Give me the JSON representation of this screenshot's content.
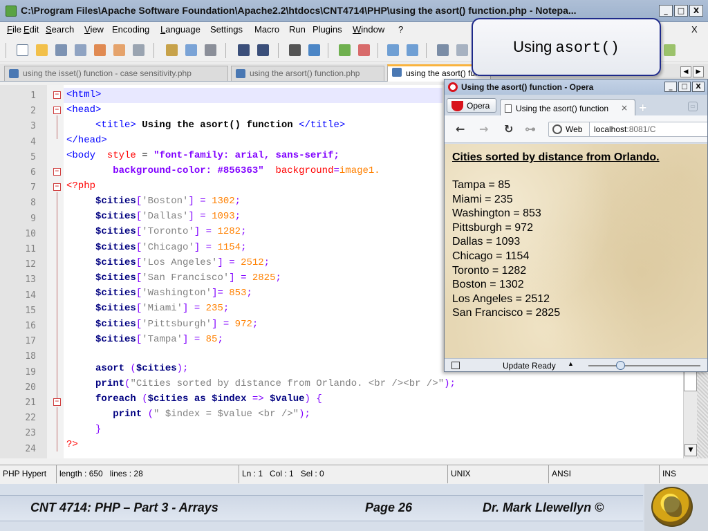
{
  "npp": {
    "title": "C:\\Program Files\\Apache Software Foundation\\Apache2.2\\htdocs\\CNT4714\\PHP\\using the asort() function.php - Notepa...",
    "window_buttons": [
      "_",
      "□",
      "X"
    ],
    "menu": [
      "File",
      "Edit",
      "Search",
      "View",
      "Encoding",
      "Language",
      "Settings",
      "Macro",
      "Run",
      "Plugins",
      "Window",
      "?"
    ],
    "menu_close": "X",
    "tabs": [
      "using the isset() function - case sensitivity.php",
      "using the arsort() function.php",
      "using the asort() function.php"
    ],
    "tab_arrows": [
      "◀",
      "▶"
    ],
    "line_numbers": [
      "1",
      "2",
      "3",
      "4",
      "5",
      "6",
      "7",
      "8",
      "9",
      "10",
      "11",
      "12",
      "13",
      "14",
      "15",
      "16",
      "17",
      "18",
      "19",
      "20",
      "21",
      "22",
      "23",
      "24"
    ],
    "code": {
      "l1": "<html>",
      "l2": "<head>",
      "l3a": "<title>",
      "l3b": " Using the asort() function ",
      "l3c": "</title>",
      "l4": "</head>",
      "l5a": "<body",
      "l5b": "style",
      "l5c": " = ",
      "l5d": "\"font-family: arial, sans-serif;",
      "l6a": "background-color: #856363\"",
      "l6b": "background",
      "l6c": "=",
      "l6d": "image1.",
      "l7": "<?php",
      "cities": [
        {
          "key": "'Boston'",
          "val": "1302"
        },
        {
          "key": "'Dallas'",
          "val": "1093"
        },
        {
          "key": "'Toronto'",
          "val": "1282"
        },
        {
          "key": "'Chicago'",
          "val": "1154"
        },
        {
          "key": "'Los Angeles'",
          "val": "2512"
        },
        {
          "key": "'San Francisco'",
          "val": "2825"
        },
        {
          "key": "'Washington'",
          "val": "853"
        },
        {
          "key": "'Miami'",
          "val": "235"
        },
        {
          "key": "'Pittsburgh'",
          "val": "972"
        },
        {
          "key": "'Tampa'",
          "val": "85"
        }
      ],
      "var_cities": "$cities",
      "l19a": "asort",
      "l19b": " (",
      "l19c": "$cities",
      "l19d": ");",
      "l20a": "print",
      "l20b": "(",
      "l20c": "\"Cities sorted by distance from Orlando. <br /><br />\"",
      "l20d": ");",
      "l21a": "foreach",
      "l21b": " (",
      "l21c": "$cities",
      "l21d": " as ",
      "l21e": "$index",
      "l21f": " => ",
      "l21g": "$value",
      "l21h": ") {",
      "l22a": "print",
      "l22b": " (",
      "l22c": "\" $index = $value <br />\"",
      "l22d": ");",
      "l23": "}",
      "l24": "?>"
    },
    "status": {
      "type": "PHP Hypert",
      "length": "length : 650",
      "lines": "lines : 28",
      "pos": "Ln : 1   Col : 1   Sel : 0",
      "eol": "UNIX",
      "encoding": "ANSI",
      "mode": "INS"
    }
  },
  "callout": {
    "word": "Using",
    "code": "asort()"
  },
  "opera": {
    "title": "Using the asort() function - Opera",
    "menu_button": "Opera",
    "tab_title": "Using the asort() function",
    "tab_close": "×",
    "new_tab": "+",
    "web_label": "Web",
    "url_host": "localhost",
    "url_rest": ":8081/C",
    "page": {
      "heading": "Cities sorted by distance from Orlando.",
      "rows": [
        "Tampa = 85",
        "Miami = 235",
        "Washington = 853",
        "Pittsburgh = 972",
        "Dallas = 1093",
        "Chicago = 1154",
        "Toronto = 1282",
        "Boston = 1302",
        "Los Angeles = 2512",
        "San Francisco = 2825"
      ]
    },
    "status_text": "Update Ready",
    "status_arrow": "▲"
  },
  "footer": {
    "course": "CNT 4714:  PHP – Part 3 - Arrays",
    "page": "Page 26",
    "author": "Dr. Mark Llewellyn ©"
  },
  "icons": {
    "nav_back": "←",
    "nav_forward": "→",
    "nav_reload": "↻",
    "nav_key": "⊶",
    "scroll_down": "▼"
  }
}
